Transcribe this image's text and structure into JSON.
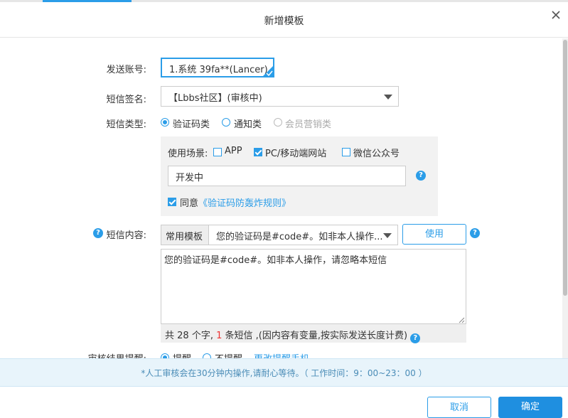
{
  "dialog": {
    "title": "新增模板"
  },
  "form": {
    "account": {
      "label": "发送账号:",
      "value": "1.系统 39fa**(Lancer)"
    },
    "signature": {
      "label": "短信签名:",
      "value": "【Lbbs社区】(审核中)"
    },
    "sms_type": {
      "label": "短信类型:",
      "options": [
        {
          "label": "验证码类",
          "checked": true,
          "disabled": false
        },
        {
          "label": "通知类",
          "checked": false,
          "disabled": false
        },
        {
          "label": "会员营销类",
          "checked": false,
          "disabled": true
        }
      ]
    },
    "scenario": {
      "label": "使用场景:",
      "options": [
        {
          "label": "APP",
          "checked": false
        },
        {
          "label": "PC/移动端网站",
          "checked": true
        },
        {
          "label": "微信公众号",
          "checked": false
        }
      ],
      "site_input_value": "开发中"
    },
    "agree": {
      "prefix": "同意",
      "link": "《验证码防轰炸规则》",
      "checked": true
    },
    "content": {
      "label": "短信内容:",
      "template_addon": "常用模板",
      "template_select": "您的验证码是#code#。如非本人操作...",
      "use_button": "使用",
      "text": "您的验证码是#code#。如非本人操作，请忽略本短信",
      "count": {
        "prefix": "共",
        "chars": "28",
        "mid": "个字,",
        "sms_count": "1",
        "suffix": "条短信 ,(因内容有变量,按实际发送长度计费)"
      }
    },
    "review": {
      "label": "审核结果提醒:",
      "options": [
        {
          "label": "提醒",
          "checked": true
        },
        {
          "label": "不提醒",
          "checked": false
        }
      ],
      "link": "更改提醒手机"
    }
  },
  "notice": "*人工审核会在30分钟内操作,请耐心等待。（ 工作时间：9：00~23：00 ）",
  "footer": {
    "cancel": "取消",
    "confirm": "确定"
  },
  "colors": {
    "accent": "#2b9de8",
    "primary_button": "#1f8fe0",
    "notice_bg": "#e8f4fb",
    "warning": "#e33333"
  },
  "icons": [
    "close-icon",
    "check-icon",
    "chevron-down-icon",
    "help-icon",
    "resize-grip-icon"
  ]
}
